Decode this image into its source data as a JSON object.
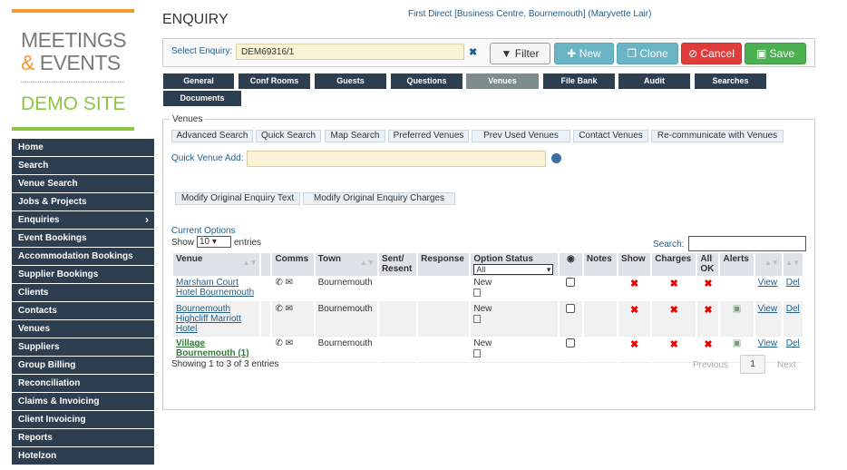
{
  "logo": {
    "line1": "MEETINGS",
    "line2_amp": "&",
    "line2": " EVENTS",
    "line3": "DEMO SITE"
  },
  "sidebar": {
    "items": [
      {
        "label": "Home"
      },
      {
        "label": "Search"
      },
      {
        "label": "Venue Search"
      },
      {
        "label": "Jobs & Projects"
      },
      {
        "label": "Enquiries",
        "chevron": "›"
      },
      {
        "label": "Event Bookings"
      },
      {
        "label": "Accommodation Bookings"
      },
      {
        "label": "Supplier Bookings"
      },
      {
        "label": "Clients"
      },
      {
        "label": "Contacts"
      },
      {
        "label": "Venues"
      },
      {
        "label": "Suppliers"
      },
      {
        "label": "Group Billing"
      },
      {
        "label": "Reconciliation"
      },
      {
        "label": "Claims & Invoicing"
      },
      {
        "label": "Client Invoicing"
      },
      {
        "label": "Reports"
      },
      {
        "label": "Hotelzon"
      }
    ]
  },
  "header": {
    "title": "ENQUIRY",
    "context": "First Direct [Business Centre, Bournemouth] (Maryvette Lair)"
  },
  "select": {
    "label": "Select Enquiry:",
    "value": "DEM69316/1",
    "clear": "✖"
  },
  "buttons": {
    "filter": "Filter",
    "new": "New",
    "clone": "Clone",
    "cancel": "Cancel",
    "save": "Save"
  },
  "icons": {
    "filter": "▼",
    "new": "✚",
    "clone": "❐",
    "cancel": "⊘",
    "save": "▣"
  },
  "tabs": [
    "General",
    "Conf Rooms",
    "Guests",
    "Questions",
    "Venues",
    "File Bank",
    "Audit",
    "Searches",
    "Documents"
  ],
  "active_tab": "Venues",
  "venues": {
    "legend": "Venues",
    "search_buttons": [
      "Advanced Search",
      "Quick Search",
      "Map Search",
      "Preferred Venues",
      "Prev Used Venues",
      "Contact Venues",
      "Re-communicate with Venues"
    ],
    "quick_add_label": "Quick Venue Add:",
    "modify_buttons": [
      "Modify Original Enquiry Text",
      "Modify Original Enquiry Charges"
    ],
    "current_options": "Current Options",
    "show_label": "Show",
    "show_value": "10",
    "entries_label": "entries",
    "search_label": "Search:",
    "columns": [
      "Venue",
      "Comms",
      "Town",
      "Sent/ Resent",
      "Response",
      "Option Status",
      "Notes",
      "Show",
      "Charges",
      "All OK",
      "Alerts"
    ],
    "option_status_filter": "All",
    "rows": [
      {
        "venue": "Marsham Court Hotel Bournemouth",
        "town": "Bournemouth",
        "status": "New",
        "show": "✖",
        "charges": "✖",
        "allok": "✖",
        "alert": false,
        "view": "View",
        "del": "Del",
        "green": false
      },
      {
        "venue": "Bournemouth Highcliff Marriott Hotel",
        "town": "Bournemouth",
        "status": "New",
        "show": "✖",
        "charges": "✖",
        "allok": "✖",
        "alert": true,
        "view": "View",
        "del": "Del",
        "green": false
      },
      {
        "venue": "Village Bournemouth (1)",
        "town": "Bournemouth",
        "status": "New",
        "show": "✖",
        "charges": "✖",
        "allok": "✖",
        "alert": true,
        "view": "View",
        "del": "Del",
        "green": true
      }
    ],
    "showing": "Showing 1 to 3 of 3 entries",
    "prev": "Previous",
    "page": "1",
    "next": "Next"
  }
}
